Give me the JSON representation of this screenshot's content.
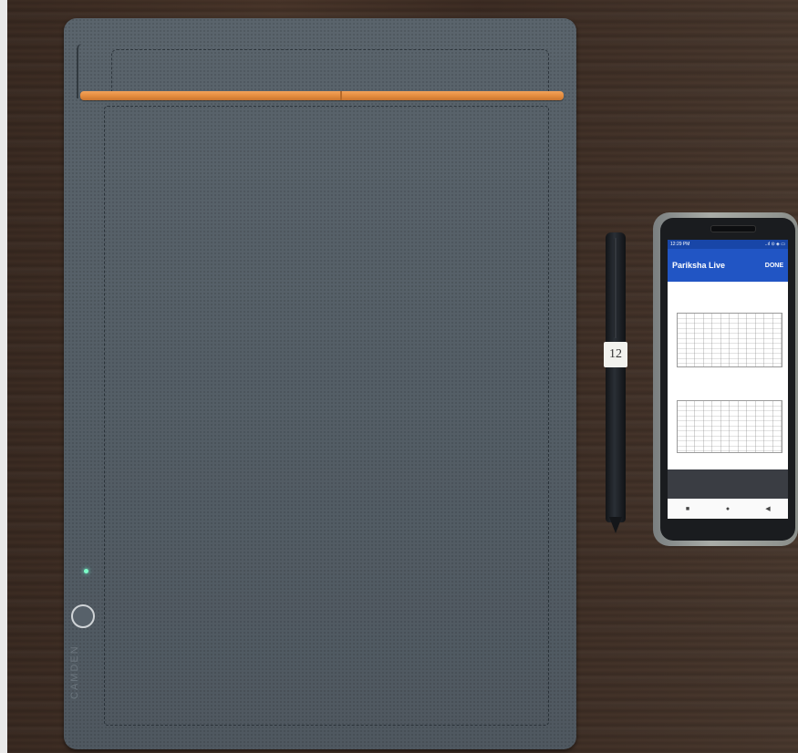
{
  "scene": {
    "description_colors": {
      "desk": "#44322a",
      "tablet": "#56606a",
      "clip_strip": "#e38b3d",
      "led": "#7cffc8",
      "app_bar": "#2155c4"
    }
  },
  "tablet": {
    "brand_label": "CAMDEN"
  },
  "pen": {
    "label": "12"
  },
  "phone": {
    "status_time": "12:29 PM",
    "status_icons": "..ıl ⊙ ◈ ▭",
    "app_title": "Pariksha Live",
    "done_label": "DONE",
    "nav": {
      "square_icon": "■",
      "circle_icon": "●",
      "back_icon": "◀"
    }
  }
}
